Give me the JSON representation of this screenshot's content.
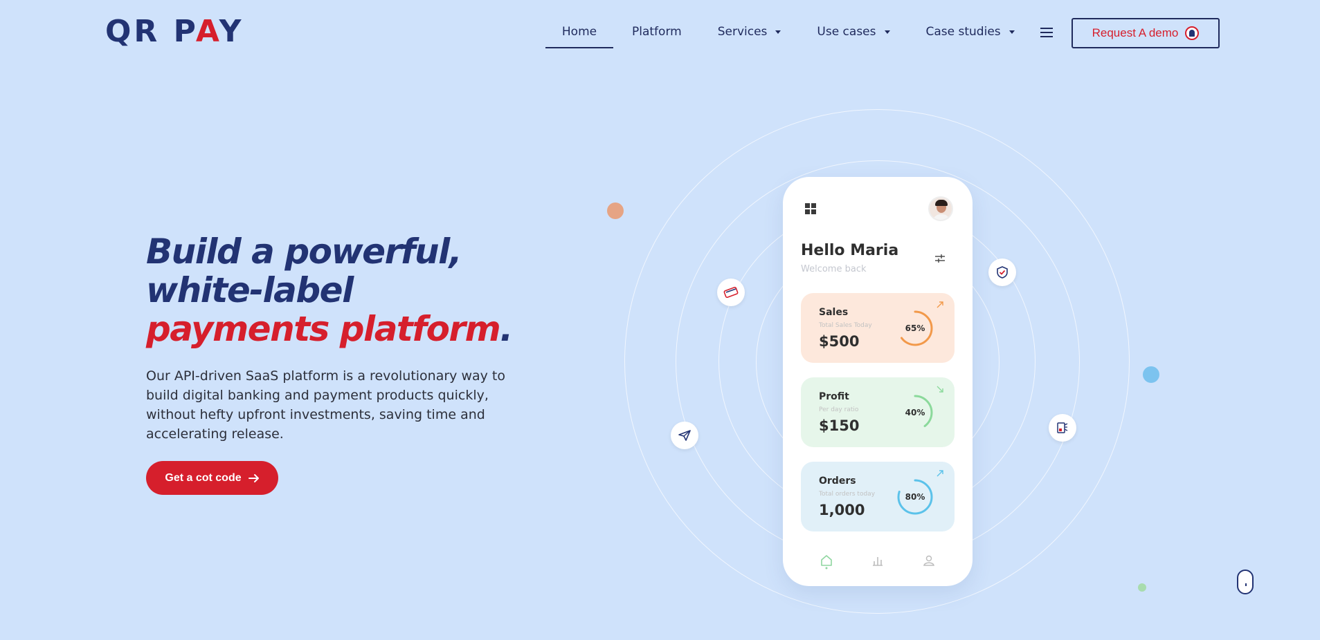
{
  "brand": {
    "logo_left": "QR P",
    "logo_slash": "A",
    "logo_right": "Y",
    "primary": "#223373",
    "accent": "#d61f2c"
  },
  "nav": {
    "items": [
      {
        "label": "Home",
        "active": true,
        "dropdown": false
      },
      {
        "label": "Platform",
        "dropdown": false
      },
      {
        "label": "Services",
        "dropdown": true
      },
      {
        "label": "Use cases",
        "dropdown": true
      },
      {
        "label": "Case studies",
        "dropdown": true
      }
    ],
    "menu_icon": "hamburger-icon",
    "demo_label": "Request A demo"
  },
  "hero": {
    "title_line1": "Build a powerful,",
    "title_line2": "white-label",
    "title_line3": "payments platform",
    "title_dot": ".",
    "description": "Our API-driven SaaS platform is a revolutionary way to build digital banking and payment products quickly, without hefty upfront investments, saving time and accelerating release.",
    "cta_label": "Get a cot code"
  },
  "phone": {
    "greeting": "Hello Maria",
    "welcome": "Welcome back",
    "cards": [
      {
        "label": "Sales",
        "sub": "Total Sales Today",
        "value": "$500",
        "percent": "65%",
        "progress": 0.65,
        "color": "#f2994a",
        "bg": "#fde8dc"
      },
      {
        "label": "Profit",
        "sub": "Per day ratio",
        "value": "$150",
        "percent": "40%",
        "progress": 0.4,
        "color": "#8bd99b",
        "bg": "#e6f6ea"
      },
      {
        "label": "Orders",
        "sub": "Total orders today",
        "value": "1,000",
        "percent": "80%",
        "progress": 0.8,
        "color": "#5bc2ea",
        "bg": "#e1f0f8"
      }
    ]
  }
}
